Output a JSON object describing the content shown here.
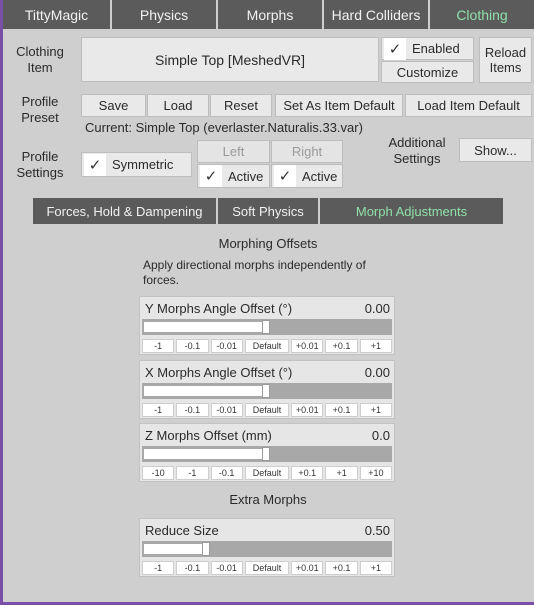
{
  "tabs": [
    {
      "label": "TittyMagic"
    },
    {
      "label": "Physics"
    },
    {
      "label": "Morphs"
    },
    {
      "label": "Hard Colliders"
    },
    {
      "label": "Clothing"
    }
  ],
  "clothing": {
    "label_line1": "Clothing",
    "label_line2": "Item",
    "selected_item": "Simple Top [MeshedVR]",
    "enabled_label": "Enabled",
    "customize_label": "Customize",
    "reload_line1": "Reload",
    "reload_line2": "Items"
  },
  "profile_preset": {
    "label_line1": "Profile",
    "label_line2": "Preset",
    "save": "Save",
    "load": "Load",
    "reset": "Reset",
    "set_default": "Set As Item Default",
    "load_default": "Load Item Default",
    "current": "Current: Simple Top (everlaster.Naturalis.33.var)"
  },
  "profile_settings": {
    "label_line1": "Profile",
    "label_line2": "Settings",
    "symmetric": "Symmetric",
    "left": "Left",
    "right": "Right",
    "left_active": "Active",
    "right_active": "Active",
    "additional_line1": "Additional",
    "additional_line2": "Settings",
    "show": "Show..."
  },
  "subtabs": [
    {
      "label": "Forces, Hold & Dampening"
    },
    {
      "label": "Soft Physics"
    },
    {
      "label": "Morph Adjustments"
    }
  ],
  "morphing": {
    "heading": "Morphing Offsets",
    "description_line1": "Apply directional morphs independently of",
    "description_line2": "forces.",
    "extra_heading": "Extra Morphs",
    "sliders": [
      {
        "title": "Y Morphs Angle Offset (°)",
        "value": "0.00",
        "level": 0.5,
        "steps": [
          "-1",
          "-0.1",
          "-0.01",
          "Default",
          "+0.01",
          "+0.1",
          "+1"
        ]
      },
      {
        "title": "X Morphs Angle Offset (°)",
        "value": "0.00",
        "level": 0.5,
        "steps": [
          "-1",
          "-0.1",
          "-0.01",
          "Default",
          "+0.01",
          "+0.1",
          "+1"
        ]
      },
      {
        "title": "Z Morphs Offset (mm)",
        "value": "0.0",
        "level": 0.5,
        "steps": [
          "-10",
          "-1",
          "-0.1",
          "Default",
          "+0.1",
          "+1",
          "+10"
        ]
      },
      {
        "title": "Reduce Size",
        "value": "0.50",
        "level": 0.25,
        "steps": [
          "-1",
          "-0.1",
          "-0.01",
          "Default",
          "+0.01",
          "+0.1",
          "+1"
        ]
      }
    ]
  },
  "colors": {
    "active_tab_text": "#8fe0a8",
    "tab_bg": "#5b5b5b",
    "panel_bg": "#cfcfcf",
    "frame_accent": "#7b4fa8"
  }
}
